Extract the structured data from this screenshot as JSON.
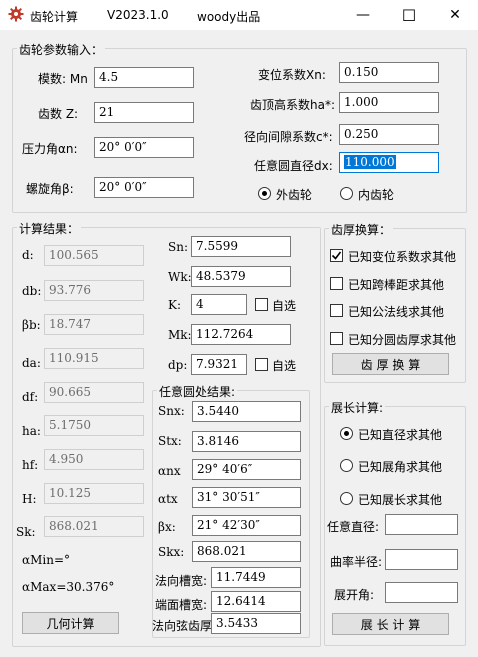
{
  "window": {
    "app_name": "齿轮计算",
    "version": "V2023.1.0",
    "author": "woody出品",
    "minimize": "—",
    "maximize": "☐",
    "close": "✕"
  },
  "params": {
    "group_label": "齿轮参数输入：",
    "module_label": "模数: Mn",
    "module_value": "4.5",
    "teeth_label": "齿数 Z:",
    "teeth_value": "21",
    "pressure_label": "压力角αn:",
    "pressure_value": "20° 0′0″",
    "helix_label": "螺旋角β:",
    "helix_value": "20° 0′0″",
    "shift_label": "变位系数Xn:",
    "shift_value": "0.150",
    "addendum_label": "齿顶高系数ha*:",
    "addendum_value": "1.000",
    "clearance_label": "径向间隙系数c*:",
    "clearance_value": "0.250",
    "anydia_label": "任意圆直径dx:",
    "anydia_value": "110.000",
    "external_label": "外齿轮",
    "external_selected": true,
    "internal_label": "内齿轮",
    "internal_selected": false
  },
  "results": {
    "group_label": "计算结果：",
    "rows": [
      {
        "label": "d:",
        "value": "100.565"
      },
      {
        "label": "db:",
        "value": "93.776"
      },
      {
        "label": "βb:",
        "value": "18.747"
      },
      {
        "label": "da:",
        "value": "110.915"
      },
      {
        "label": "df:",
        "value": "90.665"
      },
      {
        "label": "ha:",
        "value": "5.1750"
      },
      {
        "label": "hf:",
        "value": "4.950"
      },
      {
        "label": "H:",
        "value": "10.125"
      },
      {
        "label": "Sk:",
        "value": "868.021"
      }
    ],
    "alpha_min": "αMin=°",
    "alpha_max": "αMax=30.376°",
    "sn_label": "Sn:",
    "sn_value": "7.5599",
    "wk_label": "Wk:",
    "wk_value": "48.5379",
    "k_label": "K:",
    "k_value": "4",
    "k_auto_label": "自选",
    "mk_label": "Mk:",
    "mk_value": "112.7264",
    "dp_label": "dp:",
    "dp_value": "7.9321",
    "dp_auto_label": "自选",
    "calc_button": "几何计算"
  },
  "anycircle": {
    "group_label": "任意圆处结果:",
    "rows": [
      {
        "label": "Snx:",
        "value": "3.5440"
      },
      {
        "label": "Stx:",
        "value": "3.8146"
      },
      {
        "label": "αnx",
        "value": "29° 40′6″"
      },
      {
        "label": "αtx",
        "value": "31° 30′51″"
      },
      {
        "label": "βx:",
        "value": "21° 42′30″"
      },
      {
        "label": "Skx:",
        "value": "868.021"
      },
      {
        "label": "法向槽宽:",
        "value": "11.7449"
      },
      {
        "label": "端面槽宽:",
        "value": "12.6414"
      },
      {
        "label": "法向弦齿厚",
        "value": "3.5433"
      }
    ]
  },
  "thickness": {
    "group_label": "齿厚换算：",
    "options": [
      {
        "label": "已知变位系数求其他",
        "checked": true
      },
      {
        "label": "已知跨棒距求其他",
        "checked": false
      },
      {
        "label": "已知公法线求其他",
        "checked": false
      },
      {
        "label": "已知分圆齿厚求其他",
        "checked": false
      }
    ],
    "button": "齿 厚 换 算"
  },
  "unfold": {
    "group_label": "展长计算:",
    "options": [
      {
        "label": "已知直径求其他",
        "selected": true
      },
      {
        "label": "已知展角求其他",
        "selected": false
      },
      {
        "label": "已知展长求其他",
        "selected": false
      }
    ],
    "dia_label": "任意直径:",
    "dia_value": "",
    "radius_label": "曲率半径:",
    "radius_value": "",
    "angle_label": "展开角:",
    "angle_value": "",
    "button": "展 长 计 算"
  },
  "colors": {
    "accent": "#0078d7",
    "titlebar": "#ffffff",
    "window_bg": "#f0f0f0",
    "gear_icon": "#c0392b"
  }
}
